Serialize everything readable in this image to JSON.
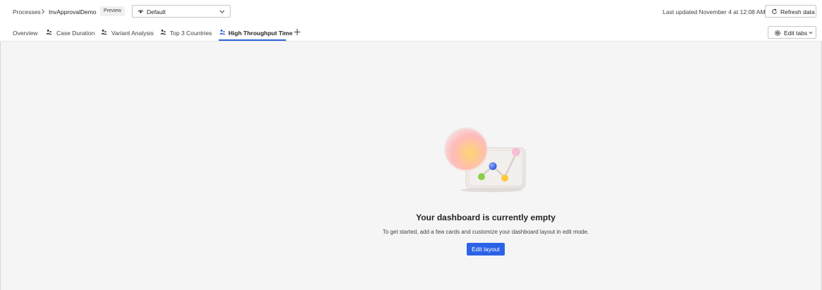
{
  "breadcrumb": {
    "root": "Processes",
    "current": "InvApprovalDemo",
    "badge": "Preview"
  },
  "view_select": {
    "value": "Default"
  },
  "header": {
    "last_updated": "Last updated November 4 at 12:08 AM",
    "refresh_label": "Refresh data"
  },
  "tabs": [
    {
      "label": "Overview",
      "icon": null,
      "active": false
    },
    {
      "label": "Case Duration",
      "icon": "people-icon",
      "active": false
    },
    {
      "label": "Variant Analysis",
      "icon": "people-icon",
      "active": false
    },
    {
      "label": "Top 3 Countries",
      "icon": "people-icon",
      "active": false
    },
    {
      "label": "High Throughput Time",
      "icon": "people-icon",
      "active": true
    }
  ],
  "edit_tabs_label": "Edit tabs",
  "empty_state": {
    "title": "Your dashboard is currently empty",
    "subtitle": "To get started, add a few cards and customize your dashboard layout in edit mode.",
    "button_label": "Edit layout"
  },
  "colors": {
    "accent": "#2c63e6",
    "background": "#f5f5f5",
    "active_tab_icon": "#2c63d6"
  }
}
